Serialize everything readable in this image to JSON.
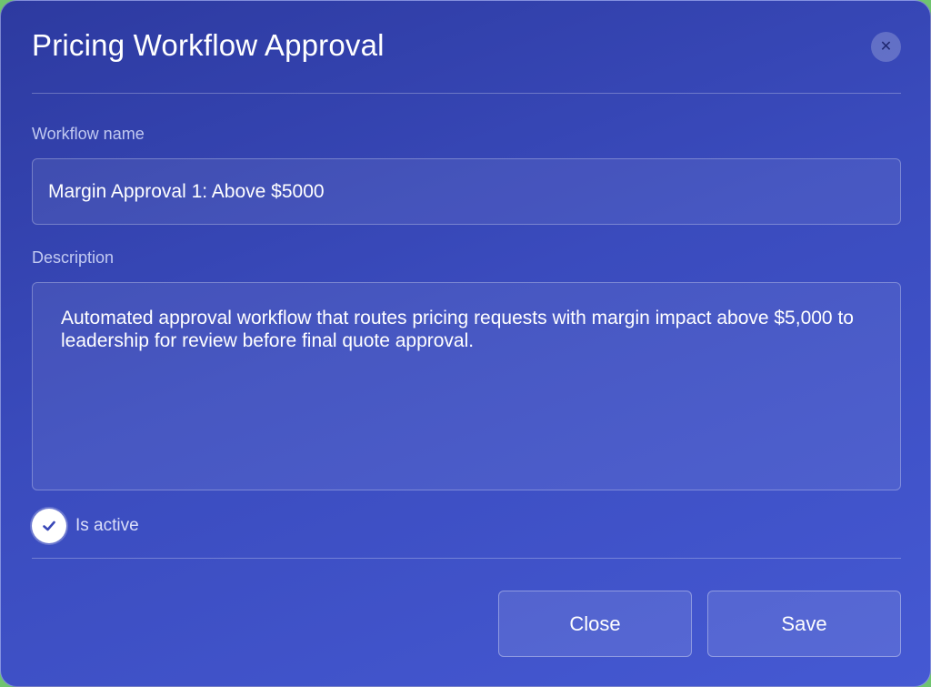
{
  "dialog": {
    "title": "Pricing Workflow Approval",
    "close_icon": "close-icon"
  },
  "form": {
    "workflow_name_label": "Workflow name",
    "workflow_name_value": "Margin Approval 1: Above $5000",
    "description_label": "Description",
    "description_value": "Automated approval workflow that routes pricing requests with margin impact above $5,000 to leadership for review before final quote approval.",
    "is_active_label": "Is active",
    "is_active_checked": true
  },
  "footer": {
    "close_label": "Close",
    "save_label": "Save"
  },
  "colors": {
    "gradient_start": "#2d3aa0",
    "gradient_end": "#4559d3",
    "text": "#ffffff"
  }
}
